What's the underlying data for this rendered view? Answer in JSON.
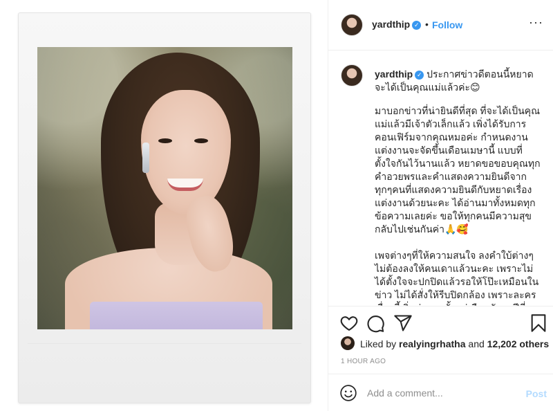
{
  "post": {
    "username": "yardthip",
    "dot": "•",
    "follow_label": "Follow",
    "more_label": "···"
  },
  "caption": {
    "username": "yardthip",
    "headline": "ประกาศข่าวดีตอนนี้หยาดจะได้เป็นคุณแม่แล้วค่ะ😊",
    "paragraph_1": "มาบอกข่าวที่น่ายินดีที่สุด ที่จะได้เป็นคุณแม่แล้วมีเจ้าตัวเล็กแล้ว เพิ่งได้รับการคอนเฟิร์มจากคุณหมอค่ะ กำหนดงานแต่งงานจะจัดขึ้นเดือนเมษานี้ แบบที่ตั้งใจกันไว้นานแล้ว หยาดขอขอบคุณทุกคำอวยพรและคำแสดงความยินดีจากทุกๆคนที่แสดงความยินดีกับหยาดเรื่องแต่งงานด้วยนะคะ ได้อ่านมาทั้งหมดทุกข้อความเลยค่ะ ขอให้ทุกคนมีความสุขกลับไปเช่นกันค่า🙏🥰",
    "paragraph_2": "เพจต่างๆที่ให้ความสนใจ ลงคำใบ้ต่างๆ ไม่ต้องลงให้คนเดาแล้วนะคะ เพราะไม่ได้ตั้งใจจะปกปิดแล้วรอให้โป๊ะเหมือนในข่าว ไม่ได้สั่งให้รีบปิดกล้อง เพราะละครเรื่องนี้เริ่มถ่ายมาตั้งแต่เดือนกันยาปีที่แล้ว มีคิวเดือนที่จะออนแอร์แจ้งมาตั้งแต่แรก และ"
  },
  "actions": {
    "like_icon": "heart-icon",
    "comment_icon": "comment-icon",
    "share_icon": "share-icon",
    "save_icon": "bookmark-icon"
  },
  "likes": {
    "prefix": "Liked by",
    "user": "realyingrhatha",
    "and": "and",
    "others": "12,202 others"
  },
  "timestamp": "1 HOUR AGO",
  "comment_box": {
    "placeholder": "Add a comment...",
    "post_label": "Post"
  },
  "colors": {
    "link_blue": "#3897f0",
    "post_disabled": "#b3dbff",
    "muted": "#8e8e8e"
  }
}
